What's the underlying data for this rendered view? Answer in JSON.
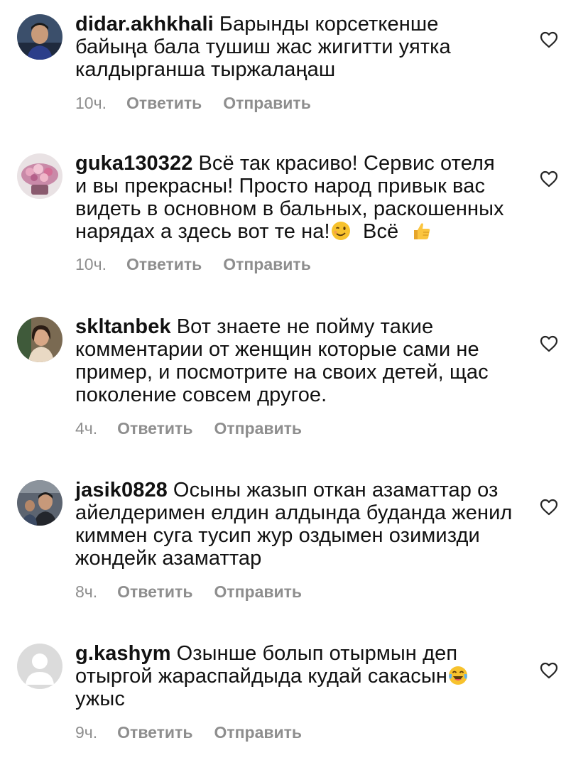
{
  "labels": {
    "reply": "Ответить",
    "send": "Отправить"
  },
  "comments": [
    {
      "username": "didar.akhkhali",
      "lines": [
        "Барынды корсеткенше",
        "байыңа бала тушиш жас жигитти уятка",
        "калдырганша тыржалаңаш"
      ],
      "time": "10ч.",
      "avatar": "man-avatar"
    },
    {
      "username": "guka130322",
      "lines": [
        "Всё так красиво! Сервис отеля",
        "и вы прекрасны! Просто народ привык вас",
        "видеть в основном в бальных, раскошенных",
        "нарядах а здесь вот те на!",
        "Всё"
      ],
      "emojis": [
        "winking-face-emoji",
        "thumbs-up-emoji"
      ],
      "time": "10ч.",
      "avatar": "flowers-avatar"
    },
    {
      "username": "skltanbek",
      "lines": [
        "Вот знаете не пойму такие",
        "комментарии от женщин которые сами не",
        "пример, и посмотрите на своих детей,  щас",
        "поколение совсем другое."
      ],
      "time": "4ч.",
      "avatar": "woman-avatar"
    },
    {
      "username": "jasik0828",
      "lines": [
        "Осыны жазып откан азаматтар оз",
        "айелдеримен елдин алдында буданда женил",
        "киммен суга тусип жур оздымен озимизди",
        "жондейк азаматтар"
      ],
      "time": "8ч.",
      "avatar": "group-avatar"
    },
    {
      "username": "g.kashym",
      "lines": [
        "Озынше болып отырмын деп",
        "отыргой  жараспайдыда кудай сакасын",
        "ужыс"
      ],
      "emojis": [
        "laughing-tears-emoji"
      ],
      "time": "9ч.",
      "avatar": "default-avatar"
    }
  ]
}
